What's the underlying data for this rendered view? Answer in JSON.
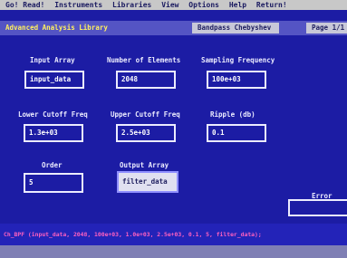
{
  "menu": [
    "Go! Read!",
    "Instruments",
    "Libraries",
    "View",
    "Options",
    "Help",
    "Return!"
  ],
  "title_bar": {
    "library": "Advanced Analysis Library",
    "function": "Bandpass Chebyshev",
    "page": "Page 1/1"
  },
  "fields": {
    "input_array": {
      "label": "Input Array",
      "value": "input_data"
    },
    "number_of_elements": {
      "label": "Number of Elements",
      "value": "2048"
    },
    "sampling_frequency": {
      "label": "Sampling Frequency",
      "value": "100e+03"
    },
    "lower_cutoff": {
      "label": "Lower Cutoff Freq",
      "value": "1.3e+03"
    },
    "upper_cutoff": {
      "label": "Upper Cutoff Freq",
      "value": "2.5e+03"
    },
    "ripple": {
      "label": "Ripple (db)",
      "value": "0.1"
    },
    "order": {
      "label": "Order",
      "value": "5"
    },
    "output_array": {
      "label": "Output Array",
      "value": "filter_data"
    }
  },
  "error": {
    "label": "Error",
    "value": ""
  },
  "command_line": "Ch_BPF (input_data, 2048, 100e+03, 1.0e+03, 2.5e+03, 0.1, 5, filter_data);",
  "colors": {
    "background": "#1c1ca4",
    "title_bar": "#5454c4",
    "library_title": "#fff060",
    "command_text": "#ff60c0"
  }
}
